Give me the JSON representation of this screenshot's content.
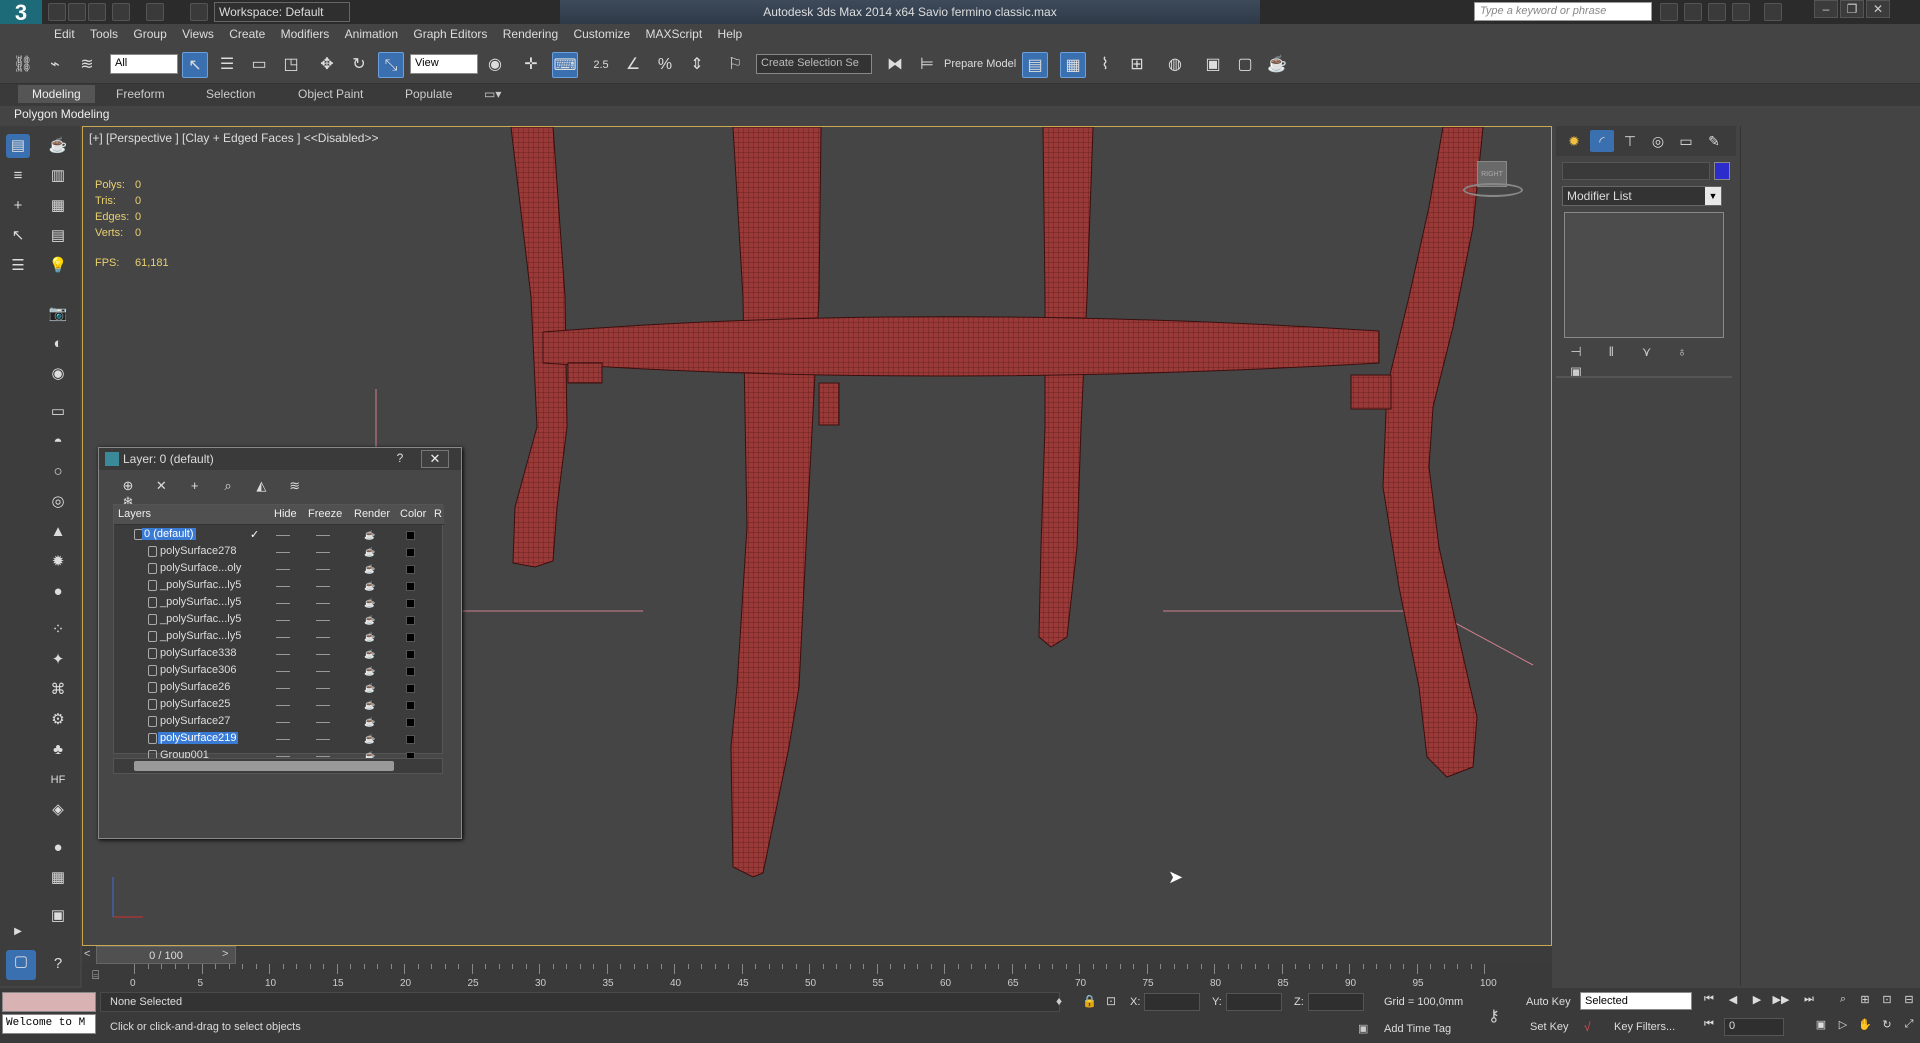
{
  "titlebar": {
    "logo": "3",
    "workspace": "Workspace: Default",
    "title": "Autodesk 3ds Max  2014 x64      Savio fermino classic.max",
    "search_placeholder": "Type a keyword or phrase"
  },
  "menu": [
    "Edit",
    "Tools",
    "Group",
    "Views",
    "Create",
    "Modifiers",
    "Animation",
    "Graph Editors",
    "Rendering",
    "Customize",
    "MAXScript",
    "Help"
  ],
  "toolbar": {
    "filter": "All",
    "refcoord": "View",
    "selection_set": "Create Selection Se",
    "prepare_model": "Prepare Model",
    "snap_angle": "2.5"
  },
  "ribbon": {
    "tabs": [
      "Modeling",
      "Freeform",
      "Selection",
      "Object Paint",
      "Populate"
    ],
    "active": "Modeling",
    "subtitle": "Polygon Modeling"
  },
  "viewport": {
    "label": "[+] [Perspective ] [Clay + Edged Faces ]  <<Disabled>>",
    "stats": [
      {
        "label": "Polys:",
        "value": "0"
      },
      {
        "label": "Tris:",
        "value": "0"
      },
      {
        "label": "Edges:",
        "value": "0"
      },
      {
        "label": "Verts:",
        "value": "0"
      }
    ],
    "fps_label": "FPS:",
    "fps_value": "61,181",
    "viewcube_label": "RIGHT",
    "model_color": "#9a3a38"
  },
  "command_panel": {
    "modifier_list": "Modifier List",
    "object_color": "#2c2ccc"
  },
  "layer_dialog": {
    "title": "Layer: 0 (default)",
    "help": "?",
    "columns": [
      "Layers",
      "Hide",
      "Freeze",
      "Render",
      "Color",
      "R"
    ],
    "rows": [
      {
        "name": "0 (default)",
        "selected": true
      },
      {
        "name": "polySurface278"
      },
      {
        "name": "polySurface...oly"
      },
      {
        "name": "_polySurfac...ly5"
      },
      {
        "name": "_polySurfac...ly5"
      },
      {
        "name": "_polySurfac...ly5"
      },
      {
        "name": "_polySurfac...ly5"
      },
      {
        "name": "polySurface338"
      },
      {
        "name": "polySurface306"
      },
      {
        "name": "polySurface26"
      },
      {
        "name": "polySurface25"
      },
      {
        "name": "polySurface27"
      },
      {
        "name": "polySurface219",
        "selected": true
      },
      {
        "name": "Group001"
      }
    ]
  },
  "timeline": {
    "slider": "0 / 100",
    "ticks": [
      "0",
      "5",
      "10",
      "15",
      "20",
      "25",
      "30",
      "35",
      "40",
      "45",
      "50",
      "55",
      "60",
      "65",
      "70",
      "75",
      "80",
      "85",
      "90",
      "95",
      "100"
    ]
  },
  "status": {
    "welcome": "Welcome to M",
    "selection": "None Selected",
    "prompt": "Click or click-and-drag to select objects",
    "x_label": "X:",
    "y_label": "Y:",
    "z_label": "Z:",
    "grid": "Grid = 100,0mm",
    "add_time_tag": "Add Time Tag",
    "auto_key": "Auto Key",
    "set_key": "Set Key",
    "key_mode": "Selected",
    "key_filters": "Key Filters...",
    "frame": "0"
  }
}
